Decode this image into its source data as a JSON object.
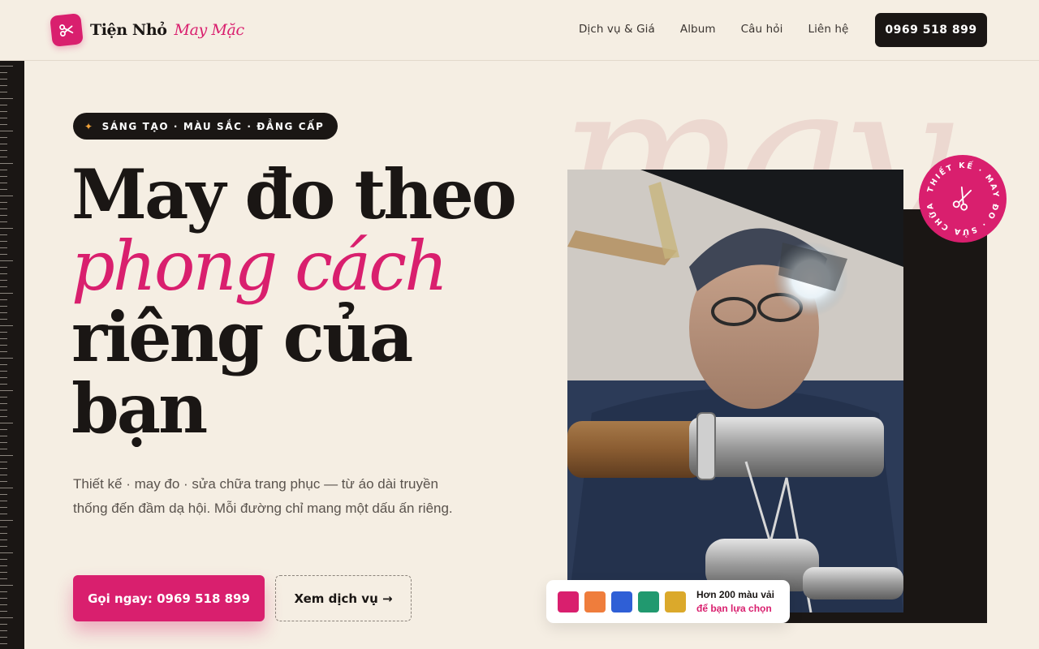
{
  "brand": {
    "name": "Tiện Nhỏ",
    "tagline": "May Mặc",
    "logo_icon": "scissors-icon",
    "accent_color": "#d91f6e",
    "dark_color": "#1a1614",
    "background_color": "#f5eee3"
  },
  "nav": {
    "items": [
      {
        "label": "Dịch vụ & Giá"
      },
      {
        "label": "Album"
      },
      {
        "label": "Câu hỏi"
      },
      {
        "label": "Liên hệ"
      }
    ],
    "phone_button": "0969 518 899"
  },
  "hero": {
    "badge_icon": "sparkle-icon",
    "badge": "SÁNG TẠO · MÀU SẮC · ĐẲNG CẤP",
    "headline_line1": "May đo theo",
    "headline_accent": "phong cách",
    "headline_line3": "riêng của",
    "headline_line4": "bạn",
    "subtitle": "Thiết kế · may đo · sửa chữa trang phục — từ áo dài truyền thống đến đầm dạ hội. Mỗi đường chỉ mang một dấu ấn riêng.",
    "cta_primary": "Gọi ngay: 0969 518 899",
    "cta_secondary": "Xem dịch vụ →",
    "background_word": "may"
  },
  "stamp": {
    "text": "THIẾT KẾ · MAY ĐO · SỬA CHỮA ·",
    "icon": "scissors-icon"
  },
  "swatch_card": {
    "colors": [
      "#d91f6e",
      "#ef7d3c",
      "#2f5fd6",
      "#21996f",
      "#dba92b"
    ],
    "line1": "Hơn 200 màu vải",
    "line2": "để bạn lựa chọn"
  }
}
